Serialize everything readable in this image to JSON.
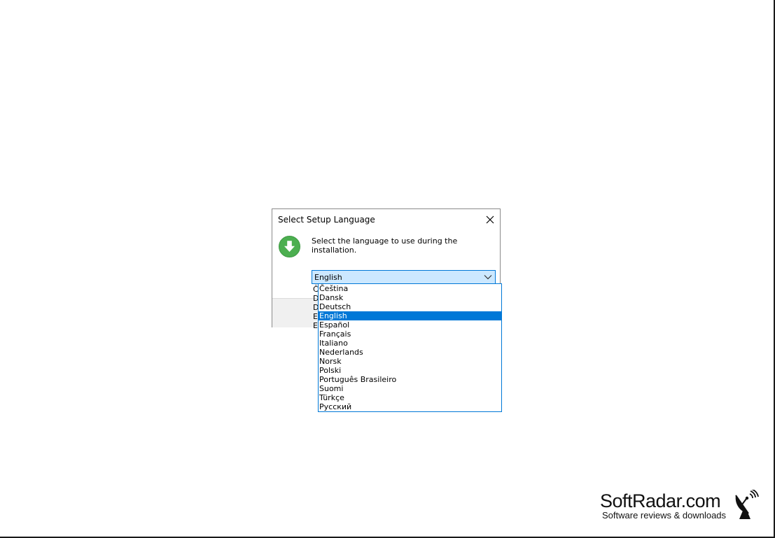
{
  "dialog": {
    "title": "Select Setup Language",
    "prompt": "Select the language to use during the installation.",
    "close_icon": "close-icon",
    "info_icon": "download-arrow-icon",
    "accent_color": "#4caf50"
  },
  "language_select": {
    "selected": "English",
    "arrow_icon": "chevron-down-icon",
    "peek_letters": [
      "Č",
      "D",
      "D",
      "E",
      "E"
    ],
    "options": [
      "Čeština",
      "Dansk",
      "Deutsch",
      "English",
      "Español",
      "Français",
      "Italiano",
      "Nederlands",
      "Norsk",
      "Polski",
      "Português Brasileiro",
      "Suomi",
      "Türkçe",
      "Русский"
    ],
    "selected_index": 3,
    "highlight_color": "#0078d7"
  },
  "watermark": {
    "brand": "SoftRadar.com",
    "tagline": "Software reviews & downloads",
    "icon": "satellite-dish-icon"
  }
}
